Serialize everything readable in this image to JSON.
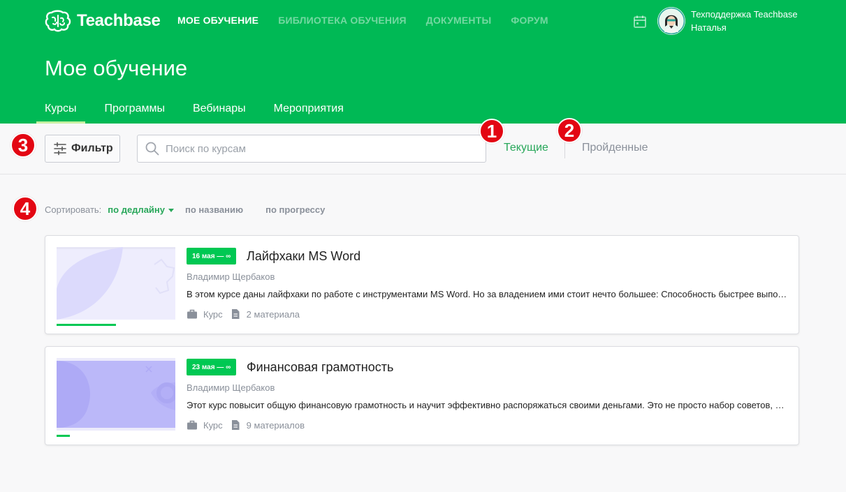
{
  "header": {
    "logo_text": "Teachbase",
    "nav": [
      {
        "label": "Мое обучение",
        "active": true
      },
      {
        "label": "Библиотека обучения",
        "active": false
      },
      {
        "label": "Документы",
        "active": false
      },
      {
        "label": "Форум",
        "active": false
      }
    ],
    "user": {
      "name": "Техподдержка Teachbase",
      "sub": "Наталья"
    },
    "page_title": "Мое обучение",
    "tabs": [
      {
        "label": "Курсы",
        "active": true
      },
      {
        "label": "Программы",
        "active": false
      },
      {
        "label": "Вебинары",
        "active": false
      },
      {
        "label": "Мероприятия",
        "active": false
      }
    ]
  },
  "toolbar": {
    "filter_label": "Фильтр",
    "search_placeholder": "Поиск по курсам",
    "segment_current": "Текущие",
    "segment_done": "Пройденные"
  },
  "markers": [
    "1",
    "2",
    "3",
    "4"
  ],
  "sort": {
    "label": "Сортировать:",
    "options": [
      "по дедлайну",
      "по названию",
      "по прогрессу"
    ],
    "active_index": 0
  },
  "courses": [
    {
      "date": "16 мая — ∞",
      "title": "Лайфхаки MS Word",
      "author": "Владимир Щербаков",
      "description": "В этом курсе даны лайфхаки по работе с инструментами MS Word. Но за владением ими стоит нечто большее: Способность быстрее выполнять задачи и повышать личную эффективность.",
      "type": "Курс",
      "materials": "2 материала",
      "progress": 0.5
    },
    {
      "date": "23 мая — ∞",
      "title": "Финансовая грамотность",
      "author": "Владимир Щербаков",
      "description": "Этот курс повысит общую финансовую грамотность и научит эффективно распоряжаться своими деньгами. Это не просто набор советов, а целая система знаний.",
      "type": "Курс",
      "materials": "9 материалов",
      "progress": 0.11
    }
  ],
  "colors": {
    "brand": "#00b955",
    "accent": "#28a75a",
    "badge": "#00c853",
    "marker": "#e30613"
  }
}
